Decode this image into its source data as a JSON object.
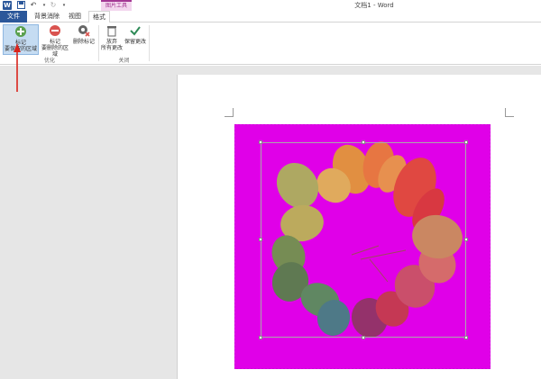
{
  "titlebar": {
    "logo_letter": "W",
    "doc_title": "文档1 - Word",
    "context_group": "图片工具",
    "quick_access": [
      "save-icon",
      "undo-icon",
      "redo-icon",
      "customize-icon"
    ]
  },
  "tabs": [
    {
      "label": "文件"
    },
    {
      "label": "背景消除"
    },
    {
      "label": "视图"
    },
    {
      "label": "格式"
    }
  ],
  "ribbon": {
    "buttons": [
      {
        "icon": "add-mark-icon",
        "label1": "标记",
        "label2": "要保留的区域",
        "selected": true
      },
      {
        "icon": "remove-mark-icon",
        "label1": "标记",
        "label2": "要删除的区域",
        "selected": false
      },
      {
        "icon": "delete-mark-icon",
        "label1": "删除标记",
        "label2": "",
        "selected": false
      },
      {
        "icon": "discard-icon",
        "label1": "放弃",
        "label2": "所有更改",
        "selected": false
      },
      {
        "icon": "keep-changes-icon",
        "label1": "保留更改",
        "label2": "",
        "selected": false
      }
    ],
    "groups": [
      {
        "label": "优化"
      },
      {
        "label": "关闭"
      }
    ]
  },
  "colors": {
    "word_blue": "#2b579a",
    "background_removal_magenta": "#e000e8",
    "annotation_red": "#d9241c"
  }
}
